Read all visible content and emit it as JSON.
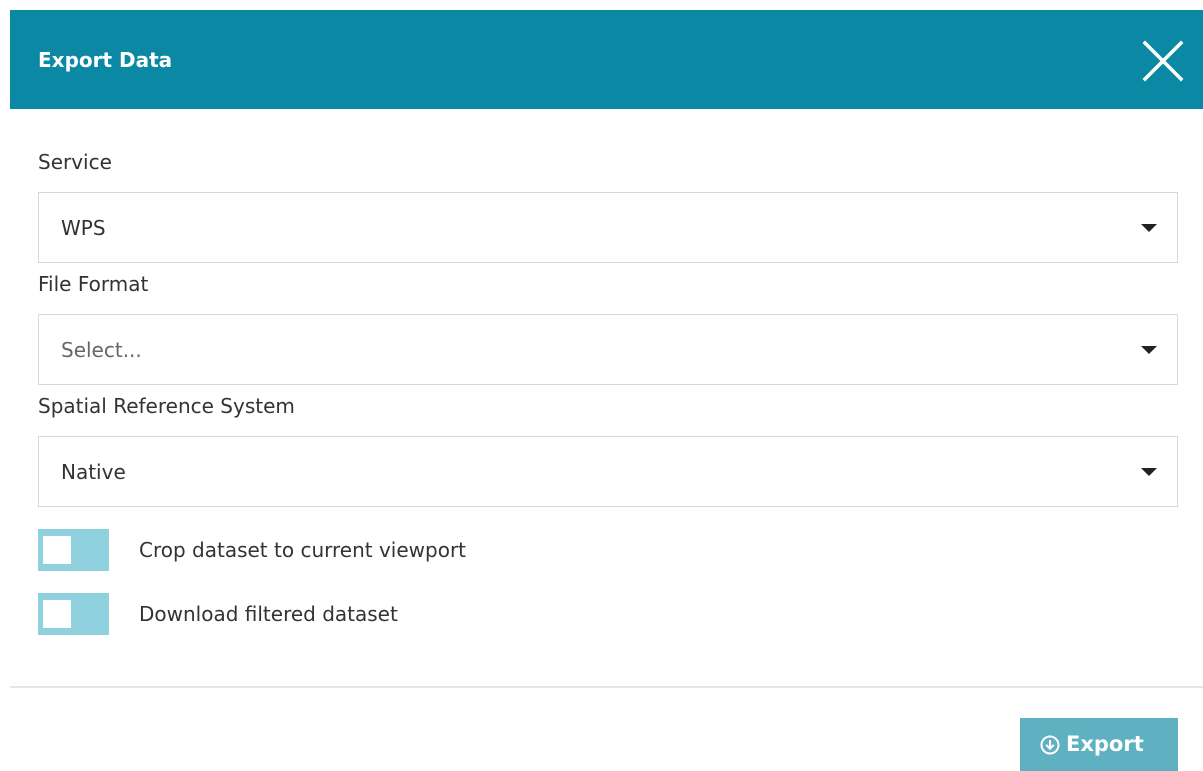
{
  "dialog": {
    "title": "Export Data",
    "close_icon": "close-icon"
  },
  "fields": {
    "service": {
      "label": "Service",
      "value": "WPS",
      "icon": "chevron-down-icon"
    },
    "file_format": {
      "label": "File Format",
      "placeholder": "Select...",
      "value": "",
      "icon": "chevron-down-icon"
    },
    "spatial_reference_system": {
      "label": "Spatial Reference System",
      "value": "Native",
      "icon": "chevron-down-icon"
    }
  },
  "toggles": [
    {
      "label": "Crop dataset to current viewport",
      "checked": false
    },
    {
      "label": "Download filtered dataset",
      "checked": false
    }
  ],
  "footer": {
    "export_label": "Export",
    "export_icon": "download-circle-icon"
  },
  "colors": {
    "header_bg": "#0b88a3",
    "toggle_bg": "#8fd1de",
    "export_bg": "#5fb0c1"
  }
}
